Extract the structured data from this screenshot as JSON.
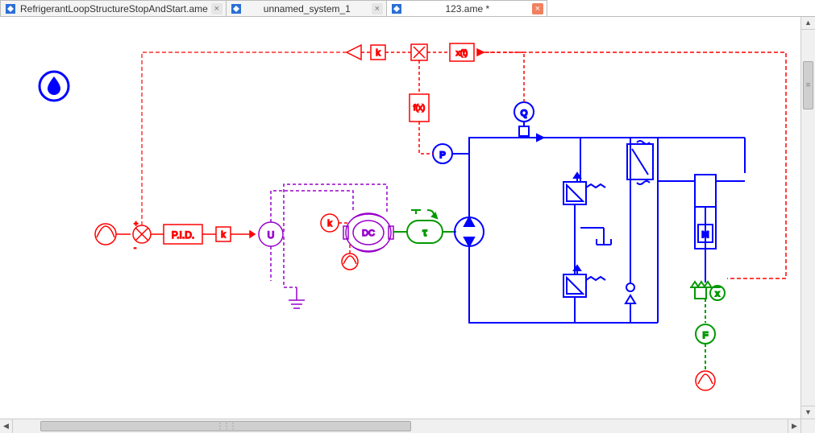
{
  "tabs": [
    {
      "label": "RefrigerantLoopStructureStopAndStart.ame",
      "active": false,
      "modified": false
    },
    {
      "label": "unnamed_system_1",
      "active": false,
      "modified": false
    },
    {
      "label": "123.ame *",
      "active": true,
      "modified": true
    }
  ],
  "diagram": {
    "labels": {
      "pid": "P.I.D.",
      "k_left": "k",
      "u": "U",
      "k_top": "k",
      "dc": "DC",
      "tau": "τ",
      "p": "P",
      "q": "Q",
      "k_red": "k",
      "fx": "f(x)",
      "xt": "x(t)",
      "m": "M",
      "x": "x",
      "f": "F"
    },
    "colors": {
      "red": "#ff0000",
      "blue": "#0000ff",
      "green": "#009900",
      "purple": "#9900cc"
    }
  }
}
